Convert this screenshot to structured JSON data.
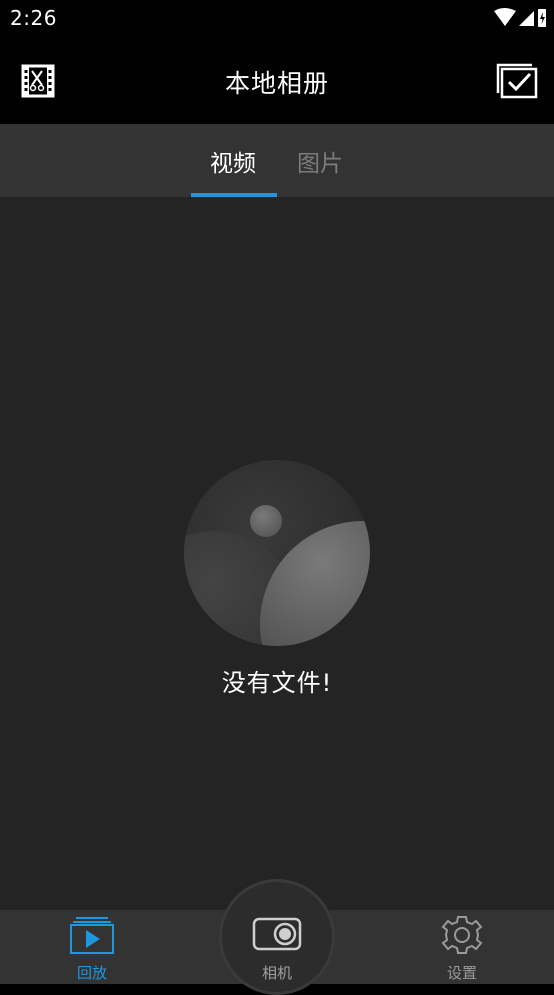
{
  "status_bar": {
    "time": "2:26",
    "icons": [
      "wifi-icon",
      "signal-icon",
      "battery-charging-icon"
    ]
  },
  "app_bar": {
    "title": "本地相册",
    "left_icon": "video-edit-icon",
    "right_icon": "select-checkbox-icon"
  },
  "tabs": [
    {
      "label": "视频",
      "active": true
    },
    {
      "label": "图片",
      "active": false
    }
  ],
  "content": {
    "empty_message": "没有文件!"
  },
  "bottom_nav": {
    "items": [
      {
        "label": "回放",
        "icon": "playback-icon",
        "active": true
      },
      {
        "label": "相机",
        "icon": "camera-icon",
        "active": false
      },
      {
        "label": "设置",
        "icon": "gear-icon",
        "active": false
      }
    ]
  },
  "colors": {
    "accent": "#1e96e2",
    "background": "#242424",
    "bar": "#333333",
    "header": "#000000"
  }
}
